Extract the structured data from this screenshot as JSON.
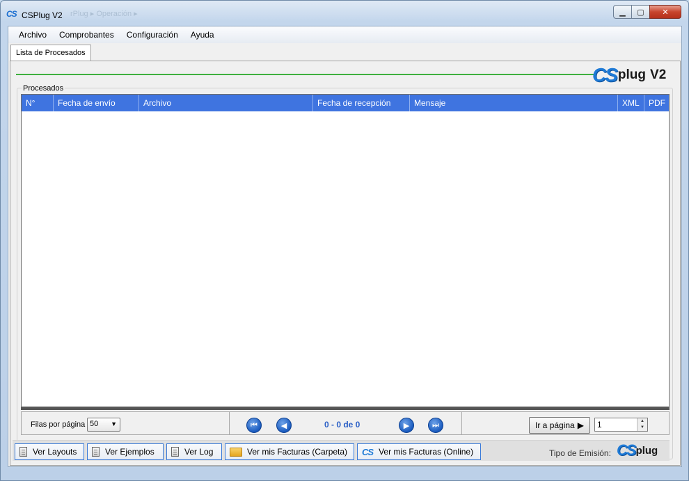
{
  "window": {
    "icon_text": "CS",
    "title": "CSPlug V2",
    "ghost_title": "rPlug  ▸  Operación  ▸"
  },
  "menu": {
    "items": [
      "Archivo",
      "Comprobantes",
      "Configuración",
      "Ayuda"
    ]
  },
  "tabs": {
    "active": "Lista de Procesados"
  },
  "logo": {
    "cs": "CS",
    "plug": "plug",
    "version": "V2"
  },
  "group": {
    "legend": "Procesados"
  },
  "grid": {
    "columns": [
      "N°",
      "Fecha de envío",
      "Archivo",
      "Fecha de recepción",
      "Mensaje",
      "XML",
      "PDF"
    ]
  },
  "pager": {
    "rows_label": "Filas por página",
    "rows_value": "50",
    "page_info": "0 - 0 de 0",
    "goto_label": "Ir a página",
    "goto_value": "1"
  },
  "bottom": {
    "buttons": [
      "Ver Layouts",
      "Ver Ejemplos",
      "Ver Log",
      "Ver mis Facturas (Carpeta)",
      "Ver mis Facturas (Online)"
    ],
    "tipo_label": "Tipo de Emisión:",
    "logo_cs": "CS",
    "logo_plug": "plug"
  },
  "colors": {
    "header_blue": "#3f74e0",
    "accent_green": "#3fb03f",
    "nav_blue": "#1a5bbf",
    "page_info_blue": "#2a5fc6"
  }
}
